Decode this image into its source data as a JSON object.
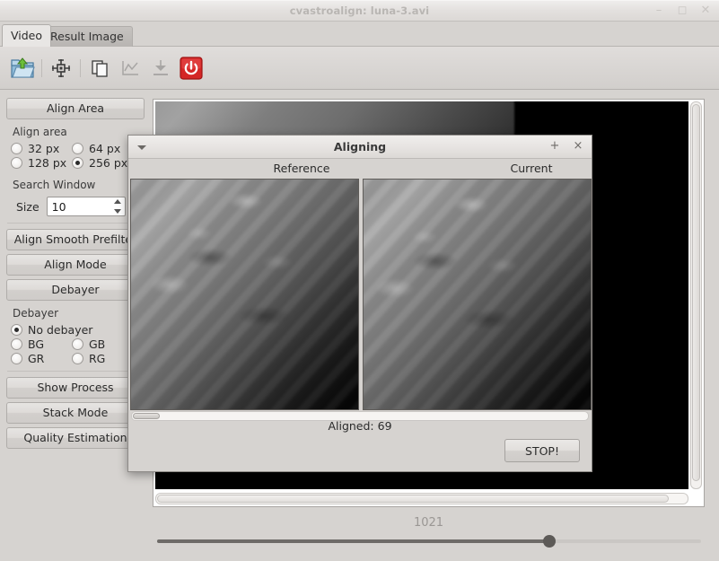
{
  "window": {
    "title": "cvastroalign: luna-3.avi",
    "minimize_label": "–",
    "maximize_label": "⬚",
    "close_label": "×"
  },
  "tabs": [
    {
      "label": "Video",
      "active": true
    },
    {
      "label": "Result Image",
      "active": false
    }
  ],
  "toolbar": {
    "items": [
      {
        "icon": "open-folder-icon",
        "enabled": true
      },
      {
        "icon": "crosshair-target-icon",
        "enabled": true
      },
      {
        "icon": "copy-icon",
        "enabled": true
      },
      {
        "icon": "chart-icon",
        "enabled": false
      },
      {
        "icon": "save-download-icon",
        "enabled": false
      },
      {
        "icon": "power-icon",
        "enabled": true
      }
    ]
  },
  "sidebar": {
    "align_area_button": "Align Area",
    "align_area_group": {
      "label": "Align area",
      "options": [
        {
          "label": "32 px",
          "checked": false
        },
        {
          "label": "64 px",
          "checked": false
        },
        {
          "label": "128 px",
          "checked": false
        },
        {
          "label": "256 px",
          "checked": true
        }
      ]
    },
    "search_window": {
      "label": "Search Window",
      "size_label": "Size",
      "size_value": "10"
    },
    "align_smooth_prefilter_button": "Align Smooth Prefilter",
    "align_mode_button": "Align Mode",
    "debayer_button": "Debayer",
    "debayer_group": {
      "label": "Debayer",
      "options": [
        {
          "label": "No debayer",
          "checked": true
        },
        {
          "label": "BG",
          "checked": false
        },
        {
          "label": "GB",
          "checked": false
        },
        {
          "label": "GR",
          "checked": false
        },
        {
          "label": "RG",
          "checked": false
        }
      ]
    },
    "show_process_button": "Show Process",
    "stack_mode_button": "Stack Mode",
    "quality_estimation_button": "Quality Estimation"
  },
  "video": {
    "frame_number": "1021"
  },
  "dialog": {
    "title": "Aligning",
    "maximize_label": "+",
    "close_label": "×",
    "reference_label": "Reference",
    "current_label": "Current",
    "status": "Aligned: 69",
    "stop_button": "STOP!"
  },
  "colors": {
    "window_bg": "#d6d3d0",
    "titlebar_bg": "#e3e0de",
    "power_red": "#cf1f1f",
    "accent_blue": "#7fa8cc",
    "text": "#2b2b2b",
    "disabled_text": "#9a9794"
  }
}
